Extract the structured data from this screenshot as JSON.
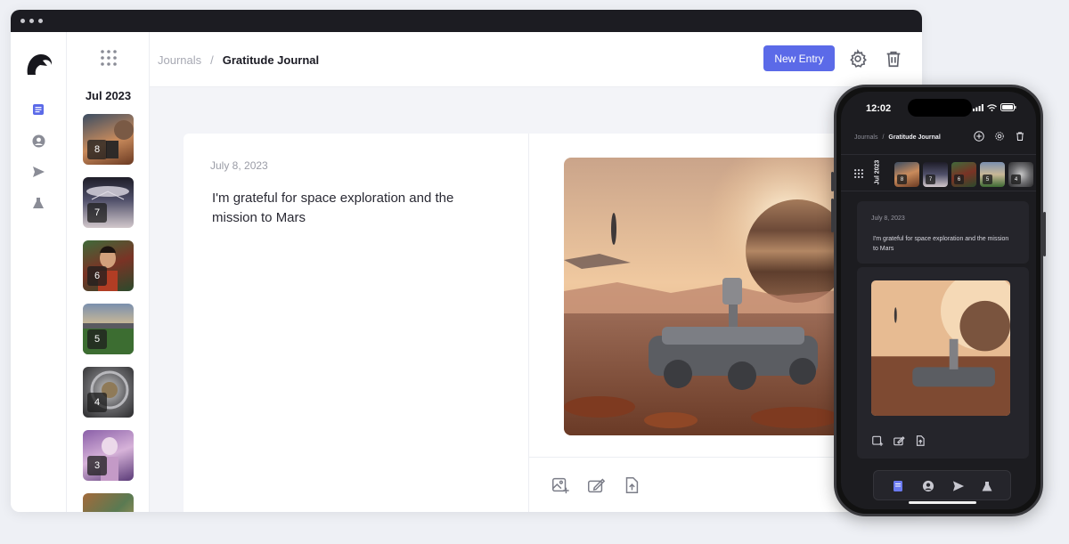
{
  "window": {
    "controls": [
      "dot",
      "dot",
      "dot"
    ]
  },
  "breadcrumb": {
    "root": "Journals",
    "separator": "/",
    "current": "Gratitude Journal"
  },
  "toolbar": {
    "new_entry_label": "New Entry",
    "settings_icon": "gear-icon",
    "delete_icon": "trash-icon"
  },
  "sidebar": {
    "icons": [
      "journal-icon",
      "profile-icon",
      "send-icon",
      "flask-icon"
    ],
    "month": "Jul 2023",
    "entries": [
      {
        "num": "8"
      },
      {
        "num": "7"
      },
      {
        "num": "6"
      },
      {
        "num": "5"
      },
      {
        "num": "4"
      },
      {
        "num": "3"
      },
      {
        "num": ""
      }
    ]
  },
  "entry": {
    "date": "July 8, 2023",
    "text": "I'm grateful for space exploration and the mission to Mars",
    "tools": [
      "add-image-icon",
      "edit-icon",
      "upload-icon"
    ]
  },
  "phone": {
    "time": "12:02",
    "breadcrumb": {
      "root": "Journals",
      "separator": "/",
      "current": "Gratitude Journal"
    },
    "month": "Jul 2023",
    "thumbs": [
      {
        "num": "8"
      },
      {
        "num": "7"
      },
      {
        "num": "6"
      },
      {
        "num": "5"
      },
      {
        "num": "4"
      }
    ],
    "entry": {
      "date": "July 8, 2023",
      "text": "I'm grateful for space exploration and the mission to Mars"
    }
  },
  "colors": {
    "accent": "#5b6ae8",
    "dark": "#1c1c22"
  }
}
